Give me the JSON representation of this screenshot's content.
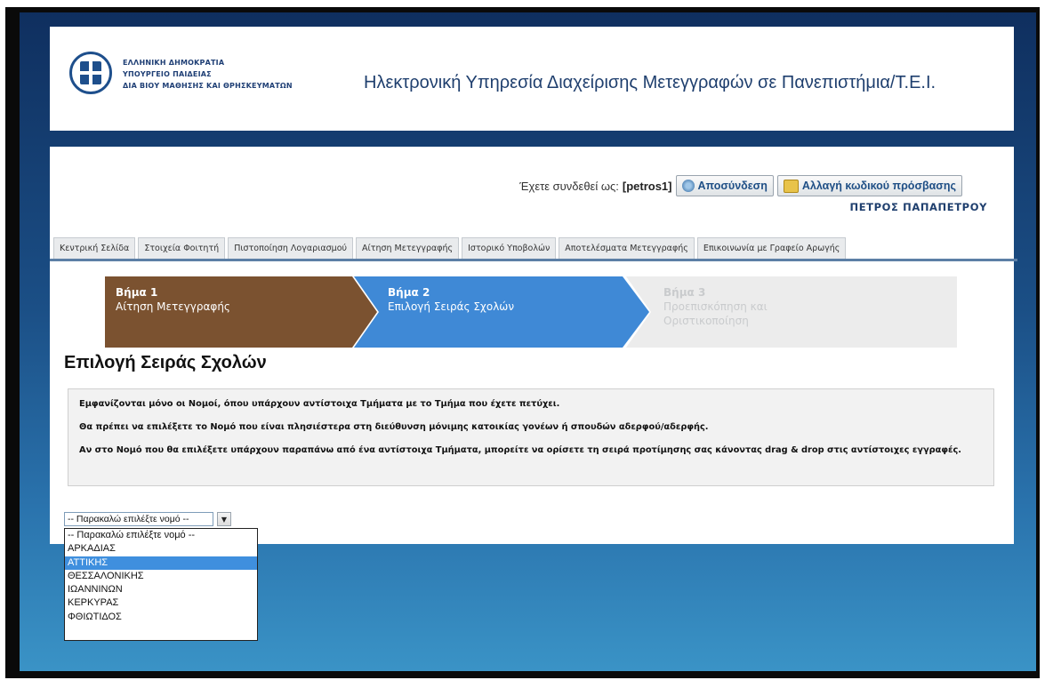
{
  "header": {
    "ministry_lines": [
      "ΕΛΛΗΝΙΚΗ ΔΗΜΟΚΡΑΤΙΑ",
      "ΥΠΟΥΡΓΕΙΟ ΠΑΙΔΕΙΑΣ",
      "ΔΙΑ ΒΙΟΥ ΜΑΘΗΣΗΣ ΚΑΙ ΘΡΗΣΚΕΥΜΑΤΩΝ"
    ],
    "title": "Ηλεκτρονική Υπηρεσία Διαχείρισης Μετεγγραφών σε Πανεπιστήμια/Τ.Ε.Ι."
  },
  "session": {
    "logged_in_label": "Έχετε συνδεθεί ως:",
    "username": "[petros1]",
    "logout_label": "Αποσύνδεση",
    "change_password_label": "Αλλαγή κωδικού πρόσβασης",
    "full_name": "ΠΕΤΡΟΣ ΠΑΠΑΠΕΤΡΟΥ"
  },
  "tabs": [
    {
      "label": "Κεντρική Σελίδα"
    },
    {
      "label": "Στοιχεία Φοιτητή"
    },
    {
      "label": "Πιστοποίηση Λογαριασμού"
    },
    {
      "label": "Αίτηση Μετεγγραφής"
    },
    {
      "label": "Ιστορικό Υποβολών"
    },
    {
      "label": "Αποτελέσματα Μετεγγραφής"
    },
    {
      "label": "Επικοινωνία με Γραφείο Αρωγής"
    }
  ],
  "wizard": {
    "steps": [
      {
        "num": "Βήμα 1",
        "label": "Αίτηση Μετεγγραφής"
      },
      {
        "num": "Βήμα 2",
        "label": "Επιλογή Σειράς Σχολών"
      },
      {
        "num": "Βήμα 3",
        "label": "Προεπισκόπηση και Οριστικοποίηση"
      }
    ],
    "colors": {
      "done": "#7b5230",
      "active": "#3f89d6",
      "pending": "#ececec"
    }
  },
  "page": {
    "title": "Επιλογή Σειράς Σχολών",
    "info": [
      "Εμφανίζονται μόνο οι Νομοί, όπου υπάρχουν αντίστοιχα Τμήματα με το Τμήμα που έχετε πετύχει.",
      "Θα πρέπει να επιλέξετε το Νομό που είναι πλησιέστερα στη διεύθυνση μόνιμης κατοικίας γονέων ή σπουδών αδερφού/αδερφής.",
      "Αν στο Νομό που θα επιλέξετε υπάρχουν παραπάνω από ένα αντίστοιχα Τμήματα, μπορείτε να ορίσετε τη σειρά προτίμησης σας κάνοντας drag & drop στις αντίστοιχες εγγραφές."
    ]
  },
  "prefecture_select": {
    "value": "-- Παρακαλώ επιλέξτε νομό --",
    "options": [
      "-- Παρακαλώ επιλέξτε νομό --",
      "ΑΡΚΑΔΙΑΣ",
      "ΑΤΤΙΚΗΣ",
      "ΘΕΣΣΑΛΟΝΙΚΗΣ",
      "ΙΩΑΝΝΙΝΩΝ",
      "ΚΕΡΚΥΡΑΣ",
      "ΦΘΙΩΤΙΔΟΣ"
    ],
    "highlighted": "ΑΤΤΙΚΗΣ"
  }
}
